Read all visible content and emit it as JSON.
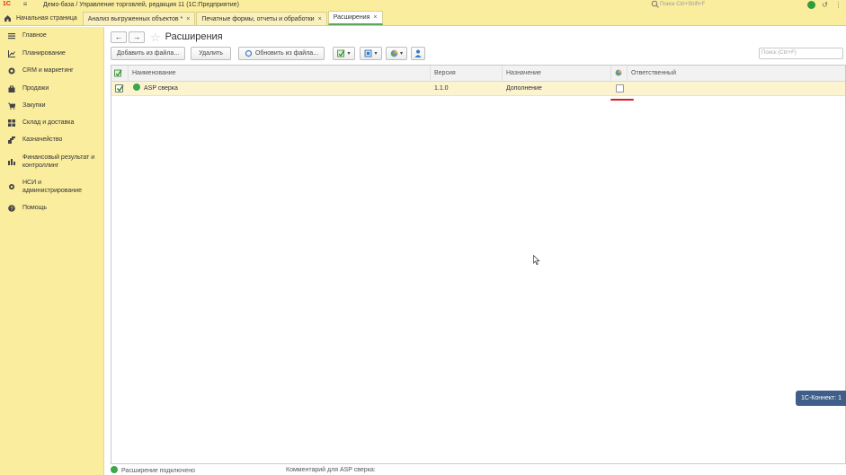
{
  "titlebar": {
    "logo": "1С",
    "title": "Демо-база / Управление торговлей, редакция 11  (1С:Предприятие)",
    "search_placeholder": "Поиск Ctrl+Shift+F"
  },
  "tabs": [
    {
      "label": "Начальная страница",
      "closable": false
    },
    {
      "label": "Анализ выгруженных объектов *",
      "closable": true
    },
    {
      "label": "Печатные формы, отчеты и обработки",
      "closable": true
    },
    {
      "label": "Расширения",
      "closable": true,
      "active": true
    }
  ],
  "sidebar": {
    "items": [
      {
        "label": "Главное",
        "icon": "menu-lines-icon"
      },
      {
        "label": "Планирование",
        "icon": "chart-icon"
      },
      {
        "label": "CRM и маркетинг",
        "icon": "crm-icon"
      },
      {
        "label": "Продажи",
        "icon": "bag-icon"
      },
      {
        "label": "Закупки",
        "icon": "cart-icon"
      },
      {
        "label": "Склад и доставка",
        "icon": "warehouse-icon"
      },
      {
        "label": "Казначейство",
        "icon": "coins-icon"
      },
      {
        "label": "Финансовый результат и контроллинг",
        "icon": "finance-icon"
      },
      {
        "label": "НСИ и администрирование",
        "icon": "gear-icon"
      },
      {
        "label": "Помощь",
        "icon": "help-icon"
      }
    ]
  },
  "page": {
    "back": "←",
    "forward": "→",
    "title": "Расширения"
  },
  "toolbar": {
    "add_from_file": "Добавить из файла...",
    "delete": "Удалить",
    "update_from_file": "Обновить из файла...",
    "search_placeholder": "Поиск (Ctrl+F)"
  },
  "table": {
    "columns": [
      "Наименование",
      "Версия",
      "Назначение",
      "Ответственный"
    ],
    "rows": [
      {
        "checked": true,
        "name": "ASP сверка",
        "version": "1.1.0",
        "purpose": "Дополнение",
        "safe_mode": false,
        "responsible": ""
      }
    ]
  },
  "connect_badge": "1С-Коннект: 1",
  "footer": {
    "status": "Расширение подключено",
    "comment_label": "Комментарий для ASP сверка:"
  },
  "colors": {
    "panel_bg": "#fbed9e",
    "selected_row": "#fcf3cf",
    "accent_green": "#3ba64a",
    "annotation_red": "#e01a1a",
    "badge_blue": "#3f5e8a"
  }
}
